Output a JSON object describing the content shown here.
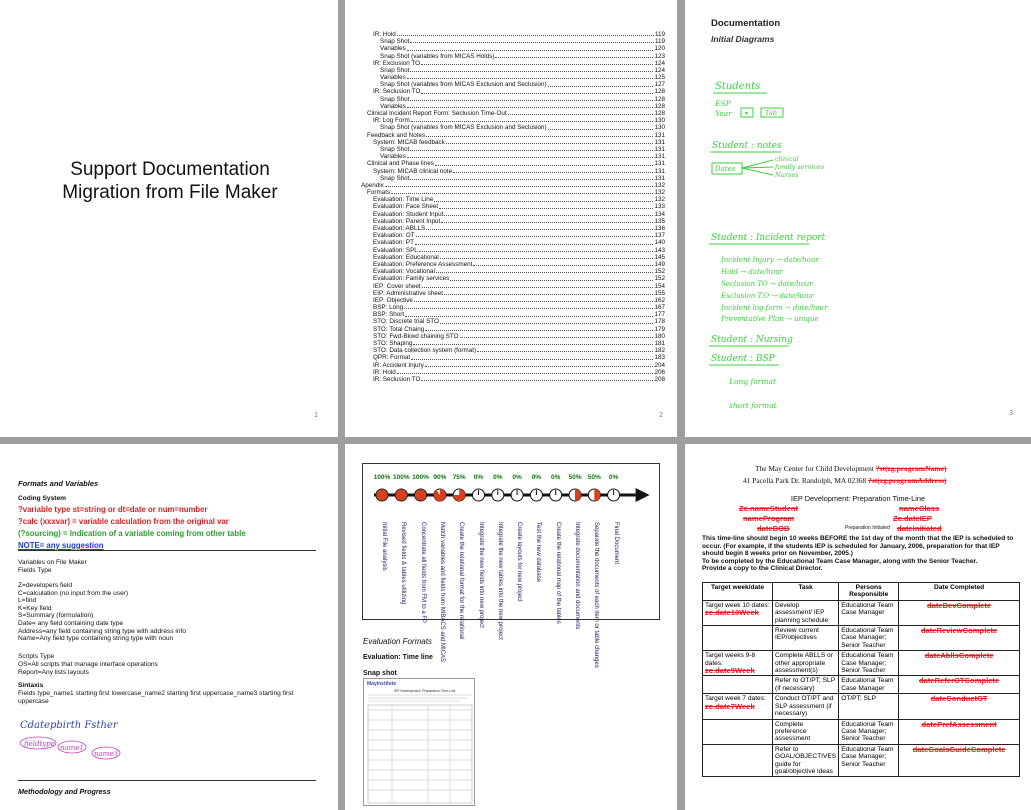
{
  "page1": {
    "title_line1": "Support Documentation",
    "title_line2": "Migration from File Maker",
    "page_num": "1"
  },
  "page2": {
    "page_num": "2",
    "toc": [
      {
        "t": "IR: Hold",
        "p": "119",
        "i": 1
      },
      {
        "t": "Snap Shot",
        "p": "119",
        "i": 2
      },
      {
        "t": "Variables",
        "p": "120",
        "i": 2
      },
      {
        "t": "Snap Shot (variables from MICAS Holds)",
        "p": "123",
        "i": 2
      },
      {
        "t": "IR: Exclusion TO",
        "p": "124",
        "i": 1
      },
      {
        "t": "Snap Shot",
        "p": "124",
        "i": 2
      },
      {
        "t": "Variables",
        "p": "125",
        "i": 2
      },
      {
        "t": "Snap Shot (variables from MICAS Exclusion and Seclusion)",
        "p": "127",
        "i": 2
      },
      {
        "t": "IR: Seclusion TO",
        "p": "128",
        "i": 1
      },
      {
        "t": "Snap Shot",
        "p": "128",
        "i": 2
      },
      {
        "t": "Variables",
        "p": "128",
        "i": 2
      },
      {
        "t": "Clinical Incident Report Form: Seclusion Time-Out",
        "p": "128",
        "i": 0
      },
      {
        "t": "IR: Log Form",
        "p": "130",
        "i": 1
      },
      {
        "t": "Snap Shot (variables from MICAS Exclusion and Seclusion)",
        "p": "130",
        "i": 2
      },
      {
        "t": "Feedback and Notes",
        "p": "131",
        "i": 0
      },
      {
        "t": "System: MICAB feedback",
        "p": "131",
        "i": 1
      },
      {
        "t": "Snap Shot",
        "p": "131",
        "i": 2
      },
      {
        "t": "Variables",
        "p": "131",
        "i": 2
      },
      {
        "t": "Clinical and Phase lines",
        "p": "131",
        "i": 0
      },
      {
        "t": "System: MICAB clinical note",
        "p": "131",
        "i": 1
      },
      {
        "t": "Snap Shot",
        "p": "131",
        "i": 2
      },
      {
        "t": "Apendix",
        "p": "132",
        "i": -1
      },
      {
        "t": "Formats",
        "p": "132",
        "i": 0
      },
      {
        "t": "Evaluation: Time Line",
        "p": "132",
        "i": 1
      },
      {
        "t": "Evaluation: Face Sheet",
        "p": "133",
        "i": 1
      },
      {
        "t": "Evaluation: Student Input",
        "p": "134",
        "i": 1
      },
      {
        "t": "Evaluation: Parent Input",
        "p": "135",
        "i": 1
      },
      {
        "t": "Evaluation: ABLLS",
        "p": "136",
        "i": 1
      },
      {
        "t": "Evaluation: OT",
        "p": "137",
        "i": 1
      },
      {
        "t": "Evaluation: PT",
        "p": "140",
        "i": 1
      },
      {
        "t": "Evaluation: SPL",
        "p": "143",
        "i": 1
      },
      {
        "t": "Evaluation: Educational",
        "p": "145",
        "i": 1
      },
      {
        "t": "Evaluation: Preference Assessment",
        "p": "149",
        "i": 1
      },
      {
        "t": "Evaluation: Vocational",
        "p": "152",
        "i": 1
      },
      {
        "t": "Evaluation: Family services",
        "p": "152",
        "i": 1
      },
      {
        "t": "IEP: Cover sheet",
        "p": "154",
        "i": 1
      },
      {
        "t": "EIP: Administrative sheet",
        "p": "155",
        "i": 1
      },
      {
        "t": "IEP: Objective",
        "p": "162",
        "i": 1
      },
      {
        "t": "BSP: Long",
        "p": "167",
        "i": 1
      },
      {
        "t": "BSP: Short",
        "p": "177",
        "i": 1
      },
      {
        "t": "STO: Discrete trial STO",
        "p": "178",
        "i": 1
      },
      {
        "t": "STO: Total Chaing",
        "p": "179",
        "i": 1
      },
      {
        "t": "STO: Fwd-Bkwd chaining STO",
        "p": "180",
        "i": 1
      },
      {
        "t": "STO: Shaping",
        "p": "181",
        "i": 1
      },
      {
        "t": "STO: Data collection system (format)",
        "p": "182",
        "i": 1
      },
      {
        "t": "QPR: Format",
        "p": "183",
        "i": 1
      },
      {
        "t": "IR: Accident Injury",
        "p": "204",
        "i": 1
      },
      {
        "t": "IR: Hold",
        "p": "206",
        "i": 1
      },
      {
        "t": "IR: Seclusion TO",
        "p": "208",
        "i": 1
      }
    ]
  },
  "page3": {
    "heading": "Documentation",
    "subheading": "Initial Diagrams",
    "page_num": "3",
    "hw": {
      "students": "Students",
      "esp": "ESP",
      "year": "Year",
      "tab": "Tab",
      "notes_title": "Student : notes",
      "dates": "Dates",
      "clinical": "clinical",
      "family": "family services",
      "nurses": "Nurses",
      "incident_title": "Student : Incident report",
      "inc1": "Incident Injury → date/hour",
      "inc2": "Hold → date/hour",
      "inc3": "Seclusion TO → date/hour",
      "inc4": "Exclusion T.O → date/hour",
      "inc5": "Incident log form → date/hour",
      "inc6": "Preventative Plan → unique",
      "nursing": "Student : Nursing",
      "bsp": "Student : BSP",
      "long": "Long format",
      "short": "short format"
    }
  },
  "page4": {
    "section": "Formats and Variables",
    "coding": "Coding  System",
    "red1": "?variable type st=string or dt=date or num=number",
    "red2": "?calc (xxxvar) = variable calculation from the original var",
    "green": "(?sourcing) = Indication of a variable coming from other table",
    "note": "NOTE= any suggestion",
    "vars_h": "Variables on File Maker",
    "fields_type": "Fields Type",
    "fields": [
      "Z=developers field",
      "C=calculation (no input from the user)",
      "L=find",
      "K=Key field",
      "S=Summary (formulation)",
      "Date= any field containing date type",
      "Address=any field containing string type with address info",
      "Name=Any field type containing string type with noun"
    ],
    "scripts_type": "Scripts Type",
    "scripts": [
      "OS=All scripts that manage interface operations",
      "Report=Any lists layouts"
    ],
    "sintaxis": "Sintaxis",
    "sintaxis_text": "Fields type_name1 starting first lowercase_name2 starting first uppercase_name3 starting first uppercase",
    "hw_sample": "Cdatepbirth Fsther",
    "hw_n1": "fieldtype",
    "hw_n2": "name1",
    "hw_n3": "name3",
    "methodology": "Methodology and Progress"
  },
  "page5": {
    "percentages": [
      "100%",
      "100%",
      "100%",
      "90%",
      "75%",
      "0%",
      "0%",
      "0%",
      "0%",
      "0%",
      "50%",
      "50%",
      "0%"
    ],
    "fills": [
      1,
      1,
      1,
      0.9,
      0.75,
      0,
      0,
      0,
      0,
      0,
      0.5,
      0.5,
      0
    ],
    "tasks": [
      "Initial File analysis",
      "Revised fields & tables utilizing",
      "Concentrate all fields from FM to a FP",
      "Match variables and fields from MIBACS and MICAS",
      "Create the relational format for the relational",
      "Integrate the new fields into new project",
      "Integrate the new tables into the new project",
      "Create layouts for new project",
      "Test the new database",
      "Create the relational map of the tables",
      "Integrate documentation and documents",
      "Separate the documents of each item or table changes",
      "Final Document"
    ],
    "eval_formats": "Evaluation Formats",
    "eval_time": "Evaluation:  Time line",
    "snap": "Snap shot",
    "thumb_logo": "MayInstitute",
    "thumb_title": "IEP Development: Preparation Time-Line"
  },
  "page6": {
    "org": "The May Center for Child Development",
    "org_var": "?st(zg.programName)",
    "addr": "41 Pacella Park Dr. Randolph, MA 02368",
    "addr_var": "?st(zg.programAddress)",
    "doc_title": "IEP Development: Preparation Time-Line",
    "v_student": "Zc.nameStudent",
    "v_program": "nameProgram",
    "v_dob": "dateDOB",
    "v_class": "nameClass",
    "v_iep": "Zc.dateIEP",
    "prep": "Preparation Initiated",
    "v_init": "dateInitiated",
    "para1": "This time-line should begin 10 weeks BEFORE the 1st day of the month that the IEP is scheduled to occur.  (For example, if the students IEP is scheduled for January, 2006, preparation for that IEP should begin 8 weeks prior on November, 2005.)",
    "para2": "To be completed by the Educational Team Case Manager, along with the Senior Teacher.",
    "para3": "Provide a copy to the Clinical Director.",
    "cols": [
      "Target week/date",
      "Task",
      "Persons Responsible",
      "Date Completed"
    ],
    "rows": [
      {
        "w": "Target week 10 dates:",
        "wv": "zc.date10Week",
        "t": "Develop assessment/ IEP planning schedule",
        "p": "Educational Team Case Manager",
        "d": "dateDevComplete"
      },
      {
        "w": "",
        "wv": "",
        "t": "Review current IEP/objectives",
        "p": "Educational Team Case Manager; Senior Teacher",
        "d": "dateReviewComplete"
      },
      {
        "w": "Target weeks 9-8 dates:",
        "wv": "zc.date9Week",
        "t": "Complete ABLLS or other appropriate assessment(s)",
        "p": "Educational Team Case Manager; Senior Teacher",
        "d": "dateAbllsComplete"
      },
      {
        "w": "",
        "wv": "",
        "t": "Refer to OT/PT; SLP (if necessary)",
        "p": "Educational Team Case Manager",
        "d": "dateReferOTComplete"
      },
      {
        "w": "Target week 7 dates:",
        "wv": "zc.date7Week",
        "t": "Conduct OT/PT and SLP assessment (if necessary)",
        "p": "OT/PT; SLP",
        "d": "dateConductOT"
      },
      {
        "w": "",
        "wv": "",
        "t": "Complete preference assessment",
        "p": "Educational Team Case Manager; Senior Teacher",
        "d": "datePrefAssessment"
      },
      {
        "w": "",
        "wv": "",
        "t": "Refer to GOAL/OBJECTIVES guide  for goal/objective ideas",
        "p": "Educational Team Case Manager; Senior Teacher",
        "d": "dateGoalsGuideComplete"
      }
    ]
  },
  "colors": {
    "page_bg": "#9e9e9e",
    "green_ink": "#3ad13a",
    "red": "#e02020",
    "progress_orange": "#d9401a",
    "blue_note": "#1a3adf"
  }
}
